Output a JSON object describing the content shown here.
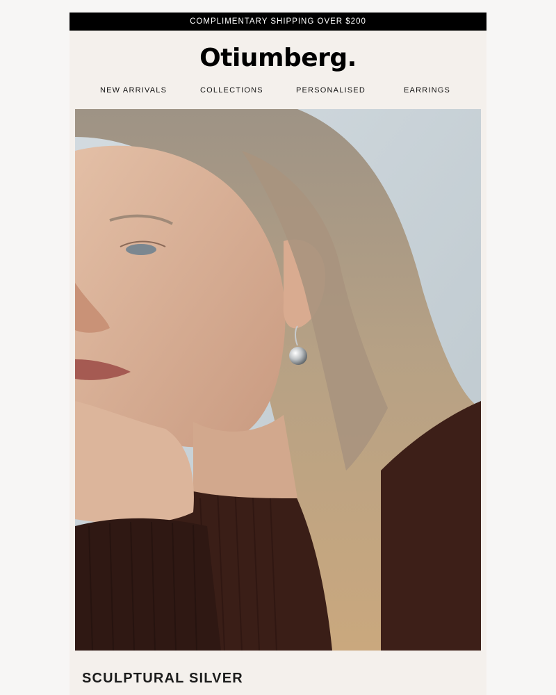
{
  "promo": {
    "text": "COMPLIMENTARY SHIPPING OVER $200"
  },
  "brand": {
    "logo": "Otiumberg."
  },
  "nav": {
    "items": [
      {
        "label": "NEW ARRIVALS"
      },
      {
        "label": "COLLECTIONS"
      },
      {
        "label": "PERSONALISED"
      },
      {
        "label": "EARRINGS"
      }
    ]
  },
  "hero": {
    "image": "portrait-woman-silver-drop-earring"
  },
  "section": {
    "title": "SCULPTURAL SILVER"
  },
  "colors": {
    "promo_bg": "#000000",
    "panel_bg": "#f4f0ec",
    "page_bg": "#f7f6f5",
    "text": "#111111"
  }
}
